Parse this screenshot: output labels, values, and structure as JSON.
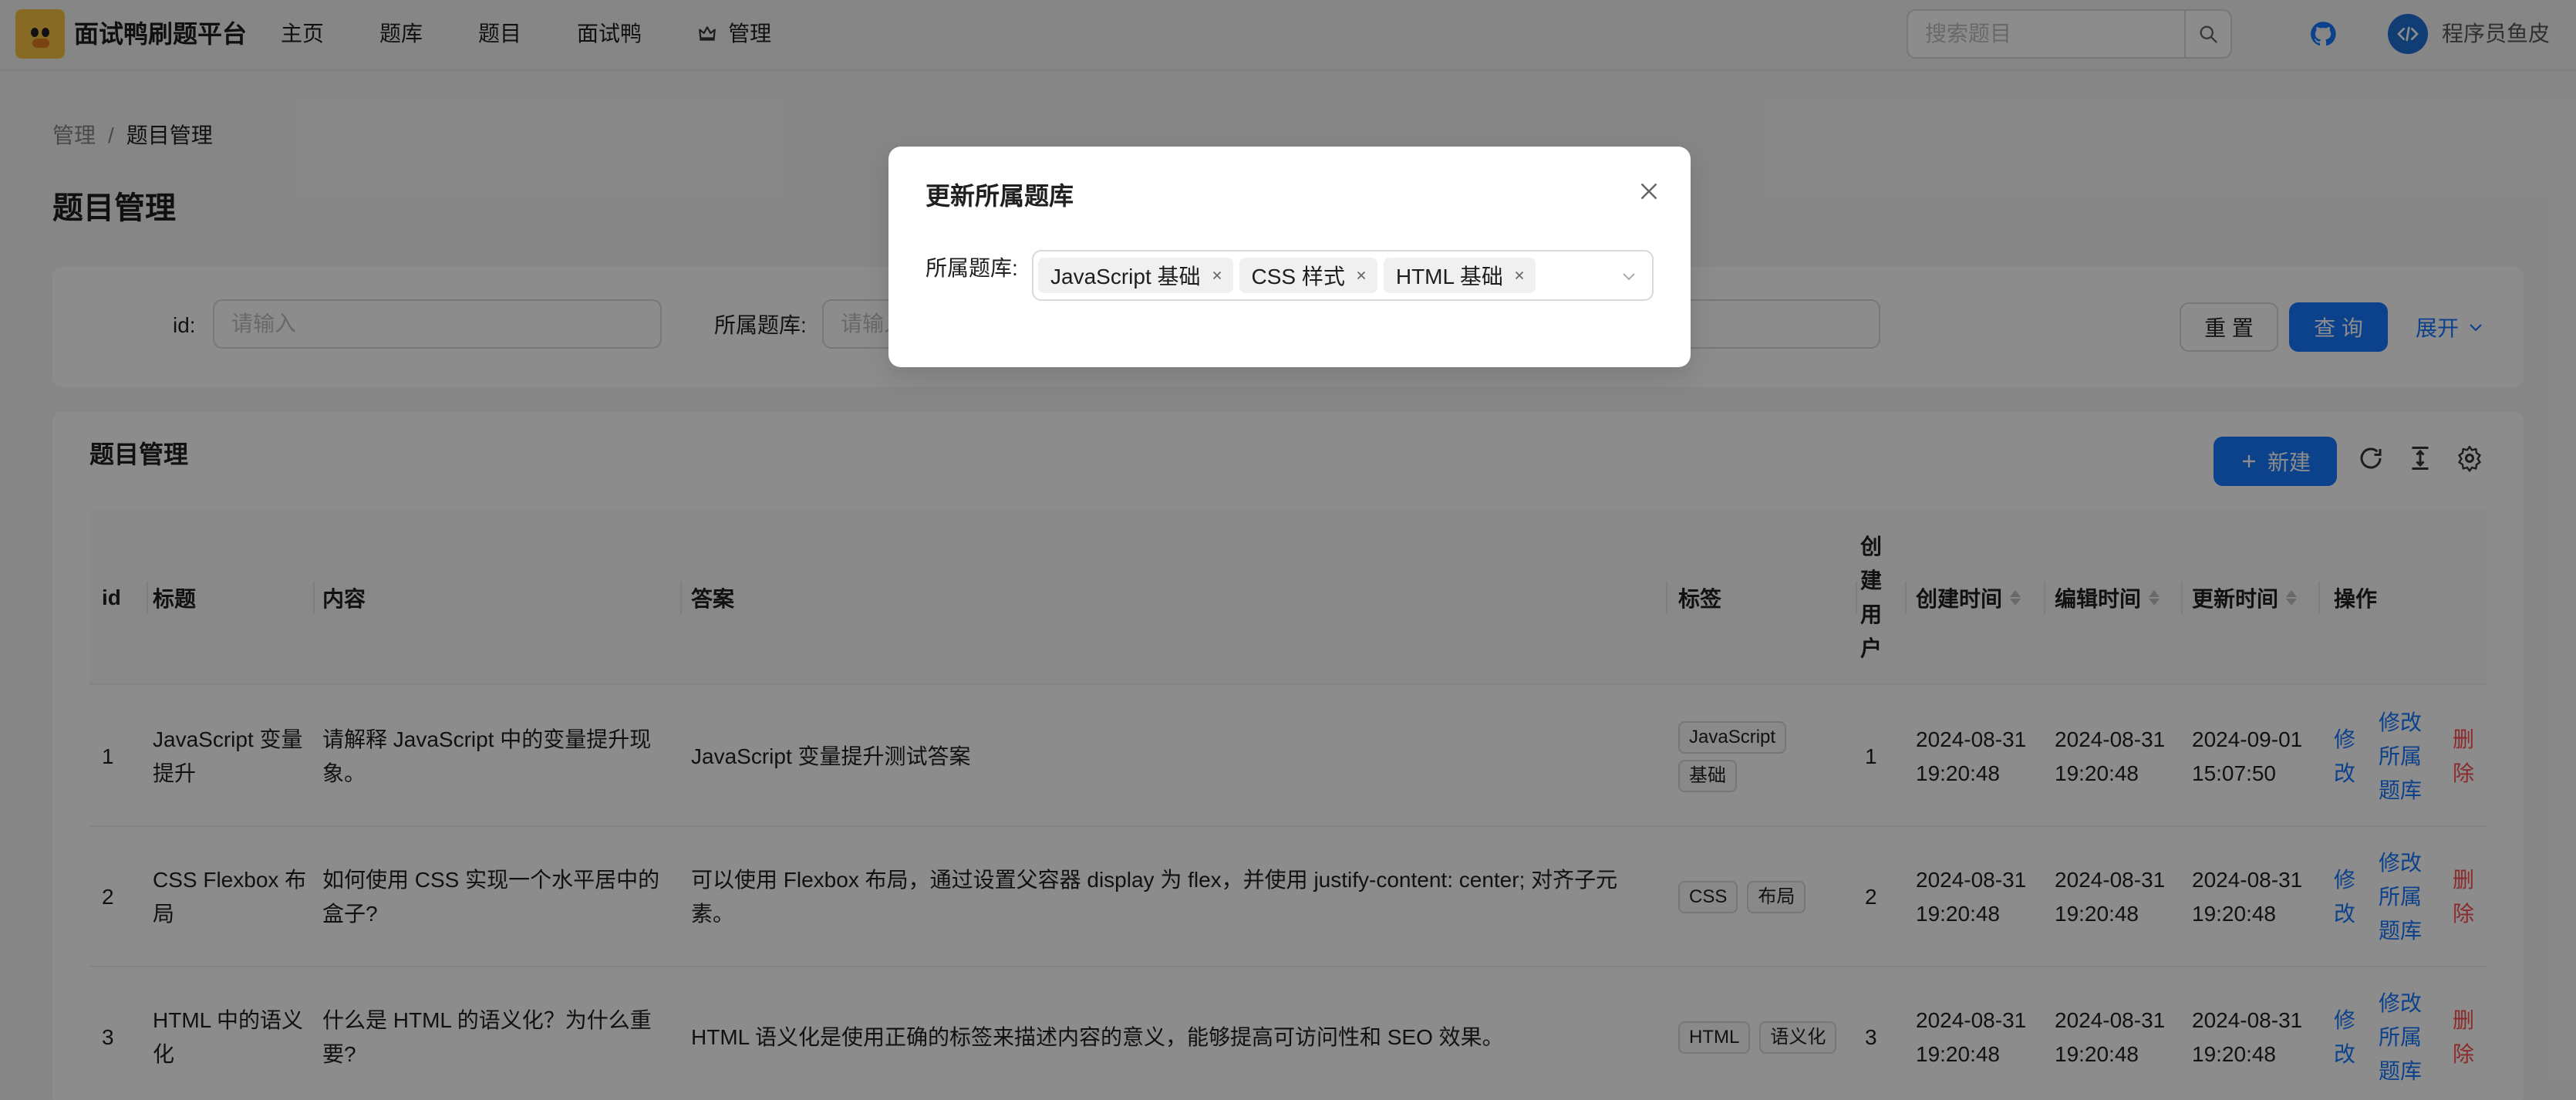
{
  "header": {
    "app_title": "面试鸭刷题平台",
    "nav": [
      "主页",
      "题库",
      "题目",
      "面试鸭",
      "管理"
    ],
    "search_placeholder": "搜索题目",
    "username": "程序员鱼皮"
  },
  "breadcrumb": {
    "parent": "管理",
    "separator": "/",
    "current": "题目管理"
  },
  "page_title": "题目管理",
  "filter": {
    "id_label": "id:",
    "id_placeholder": "请输入",
    "bank_label": "所属题库:",
    "bank_placeholder": "请输入",
    "reset_label": "重 置",
    "query_label": "查 询",
    "expand_label": "展开"
  },
  "table": {
    "title": "题目管理",
    "new_label": "新建",
    "columns": [
      "id",
      "标题",
      "内容",
      "答案",
      "标签",
      "创建用户",
      "创建时间",
      "编辑时间",
      "更新时间",
      "操作"
    ],
    "rows": [
      {
        "id": "1",
        "title": "JavaScript 变量提升",
        "content": "请解释 JavaScript 中的变量提升现象。",
        "answer": "JavaScript 变量提升测试答案",
        "tags": [
          "JavaScript",
          "基础"
        ],
        "user": "1",
        "created": "2024-08-31 19:20:48",
        "edited": "2024-08-31 19:20:48",
        "updated": "2024-09-01 15:07:50"
      },
      {
        "id": "2",
        "title": "CSS Flexbox 布局",
        "content": "如何使用 CSS 实现一个水平居中的盒子?",
        "answer": "可以使用 Flexbox 布局，通过设置父容器 display 为 flex，并使用 justify-content: center; 对齐子元素。",
        "tags": [
          "CSS",
          "布局"
        ],
        "user": "2",
        "created": "2024-08-31 19:20:48",
        "edited": "2024-08-31 19:20:48",
        "updated": "2024-08-31 19:20:48"
      },
      {
        "id": "3",
        "title": "HTML 中的语义化",
        "content": "什么是 HTML 的语义化？为什么重要?",
        "answer": "HTML 语义化是使用正确的标签来描述内容的意义，能够提高可访问性和 SEO 效果。",
        "tags": [
          "HTML",
          "语义化"
        ],
        "user": "3",
        "created": "2024-08-31 19:20:48",
        "edited": "2024-08-31 19:20:48",
        "updated": "2024-08-31 19:20:48"
      }
    ],
    "actions": {
      "edit": "修改",
      "edit_bank": "修改所属题库",
      "delete": "删除"
    }
  },
  "modal": {
    "title": "更新所属题库",
    "field_label": "所属题库:",
    "selected": [
      "JavaScript 基础",
      "CSS 样式",
      "HTML 基础"
    ]
  },
  "colors": {
    "primary": "#1677ff",
    "danger": "#ff4d4f",
    "mask": "rgba(0,0,0,0.45)"
  }
}
